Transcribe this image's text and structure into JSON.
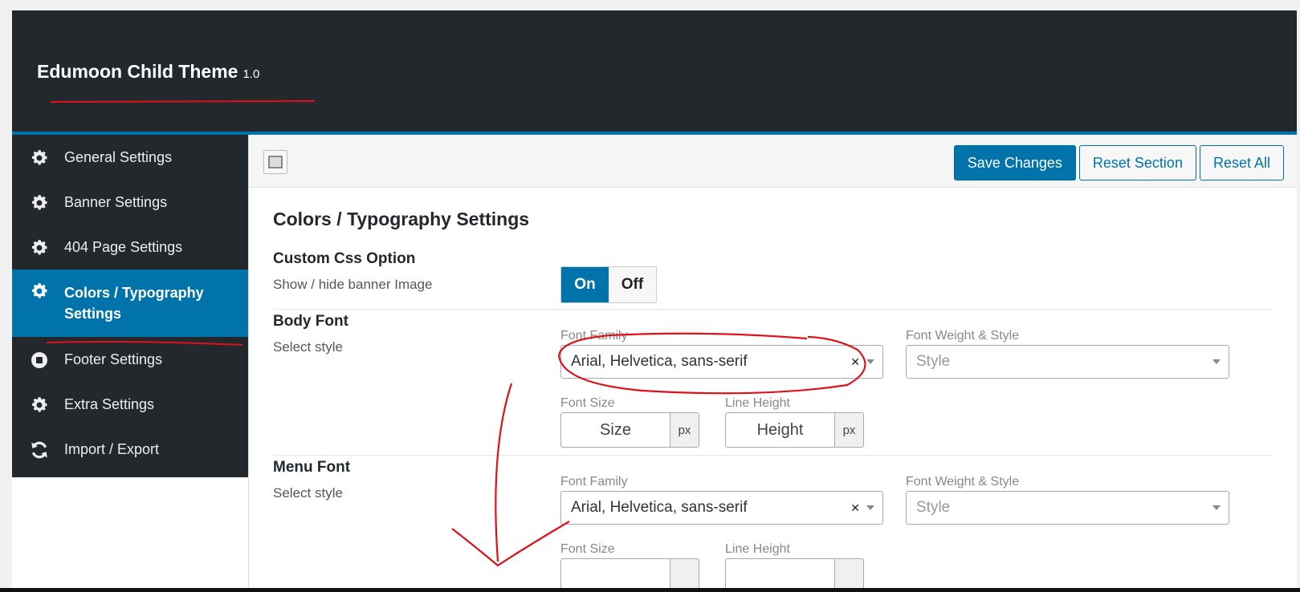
{
  "header": {
    "theme_name": "Edumoon Child Theme",
    "version": "1.0"
  },
  "sidebar": {
    "items": [
      {
        "label": "General Settings",
        "icon": "gear-icon"
      },
      {
        "label": "Banner Settings",
        "icon": "gear-icon"
      },
      {
        "label": "404 Page Settings",
        "icon": "gear-icon"
      },
      {
        "label": "Colors / Typography Settings",
        "icon": "gear-icon",
        "active": true
      },
      {
        "label": "Footer Settings",
        "icon": "stop-circle-icon"
      },
      {
        "label": "Extra Settings",
        "icon": "gear-icon"
      },
      {
        "label": "Import / Export",
        "icon": "refresh-icon"
      }
    ]
  },
  "toolbar": {
    "save_label": "Save Changes",
    "reset_section_label": "Reset Section",
    "reset_all_label": "Reset All"
  },
  "main": {
    "title": "Colors / Typography Settings",
    "custom_css": {
      "label": "Custom Css Option",
      "desc": "Show / hide banner Image",
      "on": "On",
      "off": "Off"
    },
    "body_font": {
      "label": "Body Font",
      "desc": "Select style",
      "font_family_label": "Font Family",
      "font_family_value": "Arial, Helvetica, sans-serif",
      "weight_label": "Font Weight & Style",
      "weight_placeholder": "Style",
      "size_label": "Font Size",
      "size_placeholder": "Size",
      "size_unit": "px",
      "line_height_label": "Line Height",
      "line_height_placeholder": "Height",
      "line_height_unit": "px"
    },
    "menu_font": {
      "label": "Menu Font",
      "desc": "Select style",
      "font_family_label": "Font Family",
      "font_family_value": "Arial, Helvetica, sans-serif",
      "weight_label": "Font Weight & Style",
      "weight_placeholder": "Style",
      "size_label": "Font Size",
      "line_height_label": "Line Height"
    }
  },
  "colors": {
    "accent": "#0073aa",
    "dark": "#23282d",
    "annotation": "#e0101a"
  }
}
